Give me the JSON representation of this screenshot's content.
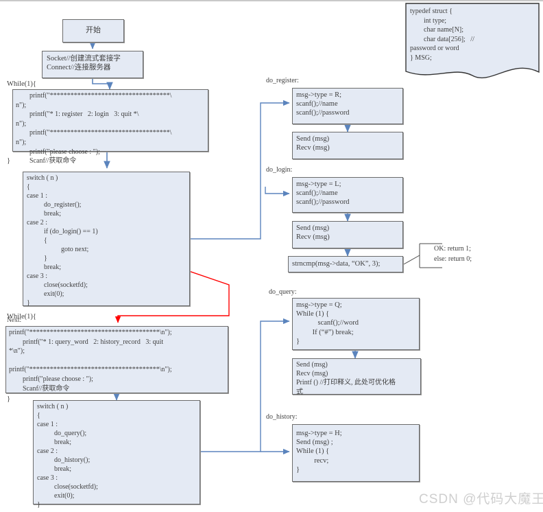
{
  "meta": {
    "watermark": "CSDN @代码大魔王",
    "colors": {
      "box_fill": "#e4eaf4",
      "box_border": "#6b6b6b",
      "arrow_blue": "#5b84bd",
      "arrow_red": "#ff0000",
      "text": "#3f3f3f",
      "watermark": "#cfcfcf"
    }
  },
  "nodes": {
    "start": {
      "text": "开始"
    },
    "socket": {
      "text": "Socket//创建流式套接字\nConnect//连接服务器"
    },
    "while1_open": {
      "text": "While(1){"
    },
    "while1_close": {
      "text": "}"
    },
    "menu1": {
      "text": "        printf(\"***********************************\\\nn\");\n        printf(\"* 1: register   2: login   3: quit *\\\nn\");\n        printf(\"***********************************\\\nn\");\n        printf(\"please choose : \");\n        Scanf//获取命令"
    },
    "switch1": {
      "text": "switch ( n )\n{\ncase 1 :\n          do_register();\n          break;\ncase 2 :\n          if (do_login() == 1)\n          {\n                    goto next;\n          }\n          break;\ncase 3 :\n          close(socketfd);\n          exit(0);\n}"
    },
    "while2_open": {
      "text": "While(1){"
    },
    "next_label": {
      "text": "Next:"
    },
    "while2_close": {
      "text": "}"
    },
    "menu2": {
      "text": "printf(\"**************************************\\n\");\n        printf(\"* 1: query_word   2: history_record   3: quit\n*\\n\");\n\nprintf(\"**************************************\\n\");\n        printf(\"please choose : \");\n        Scanf//获取命令"
    },
    "switch2": {
      "text": "switch ( n )\n{\ncase 1 :\n          do_query();\n          break;\ncase 2 :\n          do_history();\n          break;\ncase 3 :\n          close(socketfd);\n          exit(0);\n}"
    },
    "typedef": {
      "text": "typedef struct {\n        int type;\n        char name[N];\n        char data[256];   //\npassword or word\n} MSG;"
    },
    "do_register_label": {
      "text": "do_register:"
    },
    "do_register_box": {
      "text": "msg->type = R;\nscanf();//name\nscanf();//password"
    },
    "register_send": {
      "text": "Send (msg)\nRecv (msg)"
    },
    "do_login_label": {
      "text": "do_login:"
    },
    "do_login_box": {
      "text": "msg->type = L;\nscanf();//name\nscanf();//password"
    },
    "login_send": {
      "text": "Send (msg)\nRecv (msg)"
    },
    "strncmp_box": {
      "text": "strncmp(msg->data, “OK”, 3);"
    },
    "return_note": {
      "text": "OK: return 1;\nelse: return 0;"
    },
    "do_query_label": {
      "text": "do_query:"
    },
    "do_query_box": {
      "text": "msg->type = Q;\nWhile (1) {\n            scanf();//word\n         If (“#”) break;\n}"
    },
    "query_send": {
      "text": "Send (msg)\nRecv (msg)\nPrintf () //打印释义, 此处可优化格\n式"
    },
    "do_history_label": {
      "text": "do_history:"
    },
    "do_history_box": {
      "text": "msg->type = H;\nSend (msg) ;\nWhile (1) {\n          recv;\n}"
    }
  }
}
